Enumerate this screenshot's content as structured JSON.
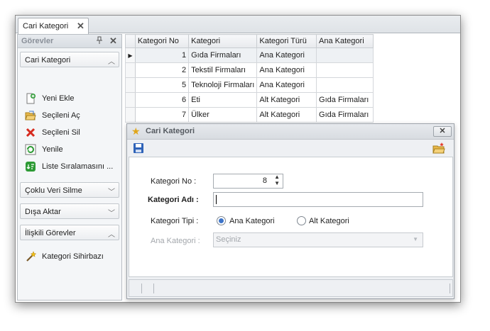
{
  "tab": {
    "label": "Cari Kategori",
    "close": "✕"
  },
  "sidebar": {
    "title": "Görevler",
    "pin": "ᵖ",
    "close": "✕",
    "groups": [
      {
        "label": "Cari Kategori",
        "expanded": true
      },
      {
        "label": "Çoklu Veri Silme",
        "expanded": false
      },
      {
        "label": "Dışa Aktar",
        "expanded": false
      },
      {
        "label": "İlişkili Görevler",
        "expanded": true
      }
    ],
    "items": [
      {
        "label": "Yeni Ekle",
        "icon": "new-document-icon"
      },
      {
        "label": "Seçileni Aç",
        "icon": "open-folder-icon"
      },
      {
        "label": "Seçileni Sil",
        "icon": "delete-x-icon"
      },
      {
        "label": "Yenile",
        "icon": "refresh-icon"
      },
      {
        "label": "Liste Sıralamasını ...",
        "icon": "list-order-icon"
      }
    ],
    "related_items": [
      {
        "label": "Kategori Sihirbazı",
        "icon": "wand-icon"
      }
    ]
  },
  "grid": {
    "columns": [
      "Kategori No",
      "Kategori",
      "Kategori Türü",
      "Ana Kategori"
    ],
    "rows": [
      {
        "no": "1",
        "kategori": "Gıda Firmaları",
        "tur": "Ana Kategori",
        "ana": ""
      },
      {
        "no": "2",
        "kategori": "Tekstil Firmaları",
        "tur": "Ana Kategori",
        "ana": ""
      },
      {
        "no": "5",
        "kategori": "Teknoloji Firmaları",
        "tur": "Ana Kategori",
        "ana": ""
      },
      {
        "no": "6",
        "kategori": "Eti",
        "tur": "Alt Kategori",
        "ana": "Gıda Firmaları"
      },
      {
        "no": "7",
        "kategori": "Ülker",
        "tur": "Alt Kategori",
        "ana": "Gıda Firmaları"
      }
    ],
    "current_row_marker": "▶"
  },
  "dialog": {
    "title": "Cari Kategori",
    "close": "✕",
    "no_label": "Kategori No :",
    "no_value": "8",
    "adi_label": "Kategori Adı :",
    "adi_value": "",
    "tip_label": "Kategori Tipi :",
    "tip_options": [
      "Ana Kategori",
      "Alt Kategori"
    ],
    "tip_selected": "Ana Kategori",
    "ana_label": "Ana Kategori :",
    "ana_placeholder": "Seçiniz"
  },
  "colors": {
    "accent": "#3d74c9",
    "delete": "#d62a1e",
    "new": "#2d9a35"
  }
}
